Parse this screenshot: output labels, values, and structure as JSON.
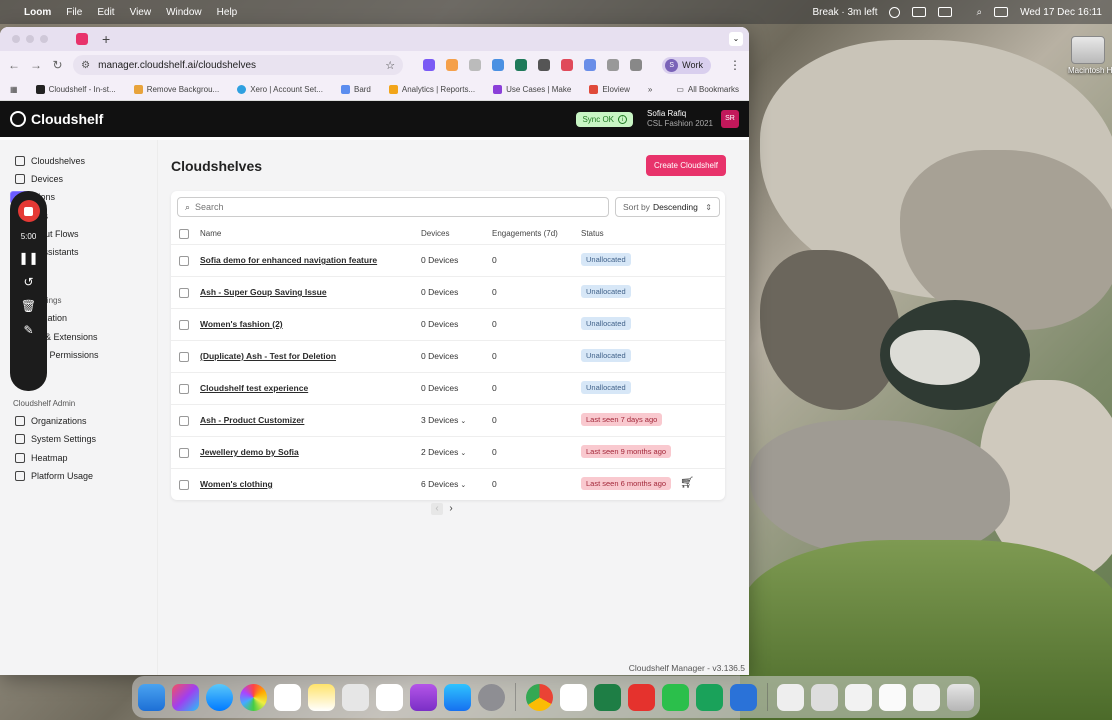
{
  "menubar": {
    "app": "Loom",
    "menus": [
      "File",
      "Edit",
      "View",
      "Window",
      "Help"
    ],
    "break_label": "Break · 3m left",
    "clock": "Wed 17 Dec  16:11"
  },
  "desktop": {
    "disk_label": "Macintosh HD"
  },
  "browser": {
    "url": "manager.cloudshelf.ai/cloudshelves",
    "profile": "Work",
    "profile_initial": "S",
    "bookmarks": [
      "Cloudshelf - In-st...",
      "Remove Backgrou...",
      "Xero | Account Set...",
      "Bard",
      "Analytics | Reports...",
      "Use Cases | Make",
      "Eloview"
    ],
    "all_bookmarks": "All Bookmarks"
  },
  "header": {
    "brand": "Cloudshelf",
    "sync": "Sync OK",
    "user_name": "Sofia Rafiq",
    "user_org": "CSL Fashion 2021",
    "user_initials": "SR"
  },
  "sidebar": {
    "items": [
      "Cloudshelves",
      "Devices",
      "ations",
      "mes",
      "ckout Flows",
      "s Assistants",
      "ge"
    ],
    "section1": "ation Settings",
    "settings": [
      "anization",
      "ins & Extensions",
      "rs & Permissions",
      "ng"
    ],
    "section2": "Cloudshelf Admin",
    "admin": [
      "Organizations",
      "System Settings",
      "Heatmap",
      "Platform Usage"
    ]
  },
  "loom_widget": {
    "time": "5:00"
  },
  "main": {
    "title": "Cloudshelves",
    "create_button": "Create Cloudshelf",
    "search_placeholder": "Search",
    "sort_prefix": "Sort by",
    "sort_value": "Descending",
    "columns": {
      "name": "Name",
      "devices": "Devices",
      "engagements": "Engagements (7d)",
      "status": "Status"
    },
    "rows": [
      {
        "name": "Sofia demo for enhanced navigation feature",
        "devices": "0 Devices",
        "engagements": "0",
        "status": "Unallocated"
      },
      {
        "name": "Ash - Super Goup Saving Issue",
        "devices": "0 Devices",
        "engagements": "0",
        "status": "Unallocated"
      },
      {
        "name": "Women's fashion (2)",
        "devices": "0 Devices",
        "engagements": "0",
        "status": "Unallocated"
      },
      {
        "name": "(Duplicate) Ash - Test for Deletion",
        "devices": "0 Devices",
        "engagements": "0",
        "status": "Unallocated"
      },
      {
        "name": "Cloudshelf test experience",
        "devices": "0 Devices",
        "engagements": "0",
        "status": "Unallocated"
      },
      {
        "name": "Ash - Product Customizer",
        "devices": "3 Devices",
        "engagements": "0",
        "status": "Last seen 7 days ago"
      },
      {
        "name": "Jewellery demo by Sofia",
        "devices": "2 Devices",
        "engagements": "0",
        "status": "Last seen 9 months ago"
      },
      {
        "name": "Women's clothing",
        "devices": "6 Devices",
        "engagements": "0",
        "status": "Last seen 6 months ago"
      }
    ],
    "version": "Cloudshelf Manager - v3.136.5"
  },
  "colors": {
    "accent": "#e8336b",
    "unallocated_bg": "#d7e7f7",
    "seen_bg": "#f9c9cf",
    "sync_bg": "#c8f5c4"
  }
}
